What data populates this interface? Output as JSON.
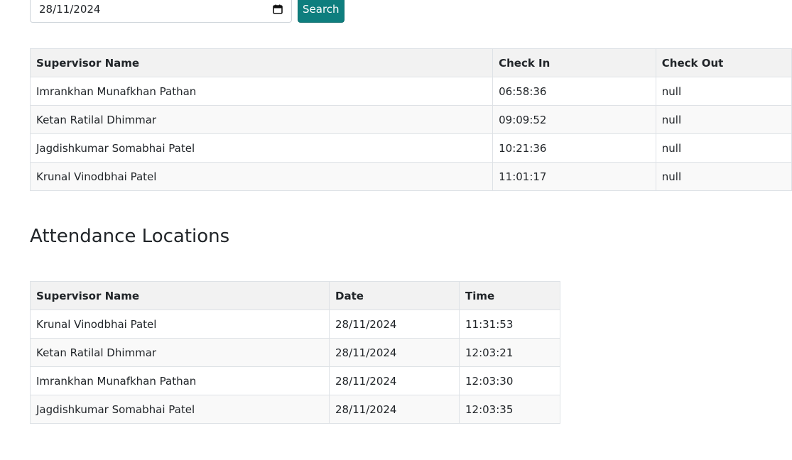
{
  "search": {
    "date_value": "28/11/2024",
    "button_label": "Search"
  },
  "attendance_table": {
    "headers": [
      "Supervisor Name",
      "Check In",
      "Check Out"
    ],
    "rows": [
      [
        "Imrankhan Munafkhan Pathan",
        "06:58:36",
        "null"
      ],
      [
        "Ketan Ratilal Dhimmar",
        "09:09:52",
        "null"
      ],
      [
        "Jagdishkumar Somabhai Patel",
        "10:21:36",
        "null"
      ],
      [
        "Krunal Vinodbhai Patel",
        "11:01:17",
        "null"
      ]
    ]
  },
  "locations_section": {
    "title": "Attendance Locations"
  },
  "locations_table": {
    "headers": [
      "Supervisor Name",
      "Date",
      "Time"
    ],
    "rows": [
      [
        "Krunal Vinodbhai Patel",
        "28/11/2024",
        "11:31:53"
      ],
      [
        "Ketan Ratilal Dhimmar",
        "28/11/2024",
        "12:03:21"
      ],
      [
        "Imrankhan Munafkhan Pathan",
        "28/11/2024",
        "12:03:30"
      ],
      [
        "Jagdishkumar Somabhai Patel",
        "28/11/2024",
        "12:03:35"
      ]
    ]
  },
  "colors": {
    "button_bg": "#0e7e7e",
    "header_bg": "#f2f2f2",
    "border": "#dee2e6"
  }
}
